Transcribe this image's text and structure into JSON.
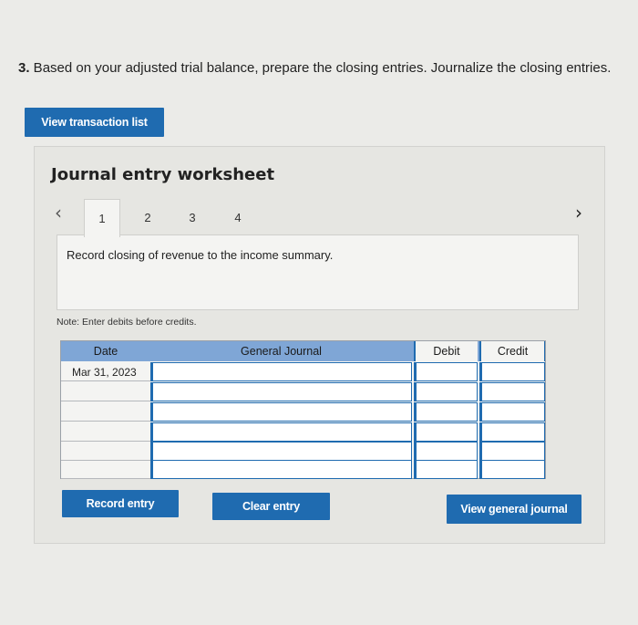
{
  "question": {
    "number": "3.",
    "text": " Based on your adjusted trial balance, prepare the closing entries. Journalize the closing entries."
  },
  "buttons": {
    "view_transactions": "View transaction list",
    "record_entry": "Record entry",
    "clear_entry": "Clear entry",
    "view_journal": "View general journal"
  },
  "worksheet": {
    "title": "Journal entry worksheet",
    "prev_icon": "chevron-left",
    "next_icon": "chevron-right",
    "tabs": [
      {
        "label": "1",
        "active": true
      },
      {
        "label": "2",
        "active": false
      },
      {
        "label": "3",
        "active": false
      },
      {
        "label": "4",
        "active": false
      }
    ],
    "description": "Record closing of revenue to the income summary.",
    "note": "Note: Enter debits before credits."
  },
  "journal": {
    "headers": {
      "date": "Date",
      "account": "General Journal",
      "debit": "Debit",
      "credit": "Credit"
    },
    "rows": [
      {
        "date": "Mar 31, 2023",
        "account": "",
        "debit": "",
        "credit": ""
      },
      {
        "date": "",
        "account": "",
        "debit": "",
        "credit": ""
      },
      {
        "date": "",
        "account": "",
        "debit": "",
        "credit": ""
      },
      {
        "date": "",
        "account": "",
        "debit": "",
        "credit": ""
      },
      {
        "date": "",
        "account": "",
        "debit": "",
        "credit": ""
      },
      {
        "date": "",
        "account": "",
        "debit": "",
        "credit": ""
      }
    ]
  },
  "colors": {
    "accent": "#1f6bb0",
    "table_header": "#7fa6d6",
    "background": "#ebebe8"
  }
}
